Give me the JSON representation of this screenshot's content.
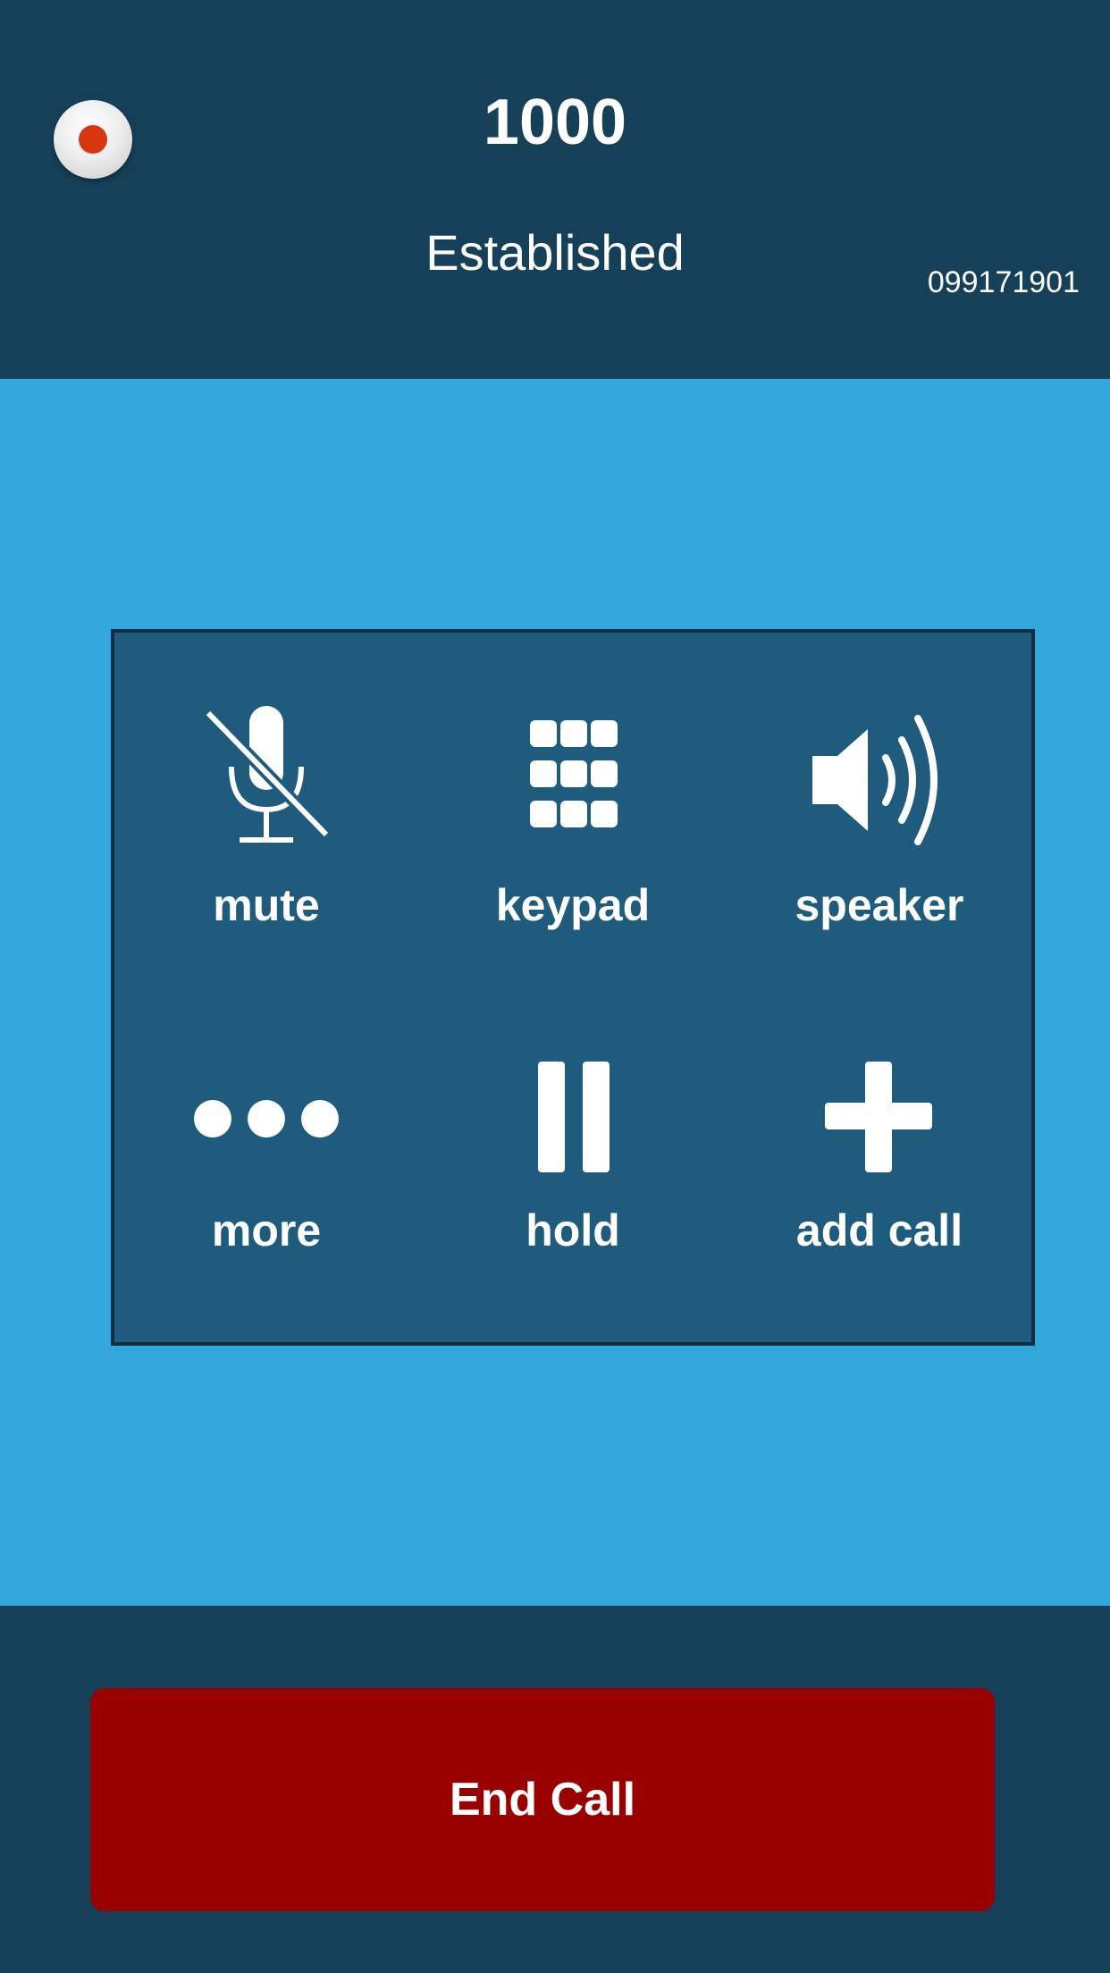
{
  "header": {
    "title": "1000",
    "status": "Established",
    "number": "099171901",
    "record_icon": "record-icon"
  },
  "controls": [
    {
      "label": "mute",
      "icon": "mute-icon"
    },
    {
      "label": "keypad",
      "icon": "keypad-icon"
    },
    {
      "label": "speaker",
      "icon": "speaker-icon"
    },
    {
      "label": "more",
      "icon": "more-icon"
    },
    {
      "label": "hold",
      "icon": "hold-icon"
    },
    {
      "label": "add call",
      "icon": "add-call-icon"
    }
  ],
  "footer": {
    "end_call_label": "End Call"
  },
  "colors": {
    "header_bg": "#154058",
    "body_bg": "#33a6dc",
    "panel_bg": "#1e5b7d",
    "end_call_bg": "#990000",
    "record_dot": "#d8360f"
  }
}
